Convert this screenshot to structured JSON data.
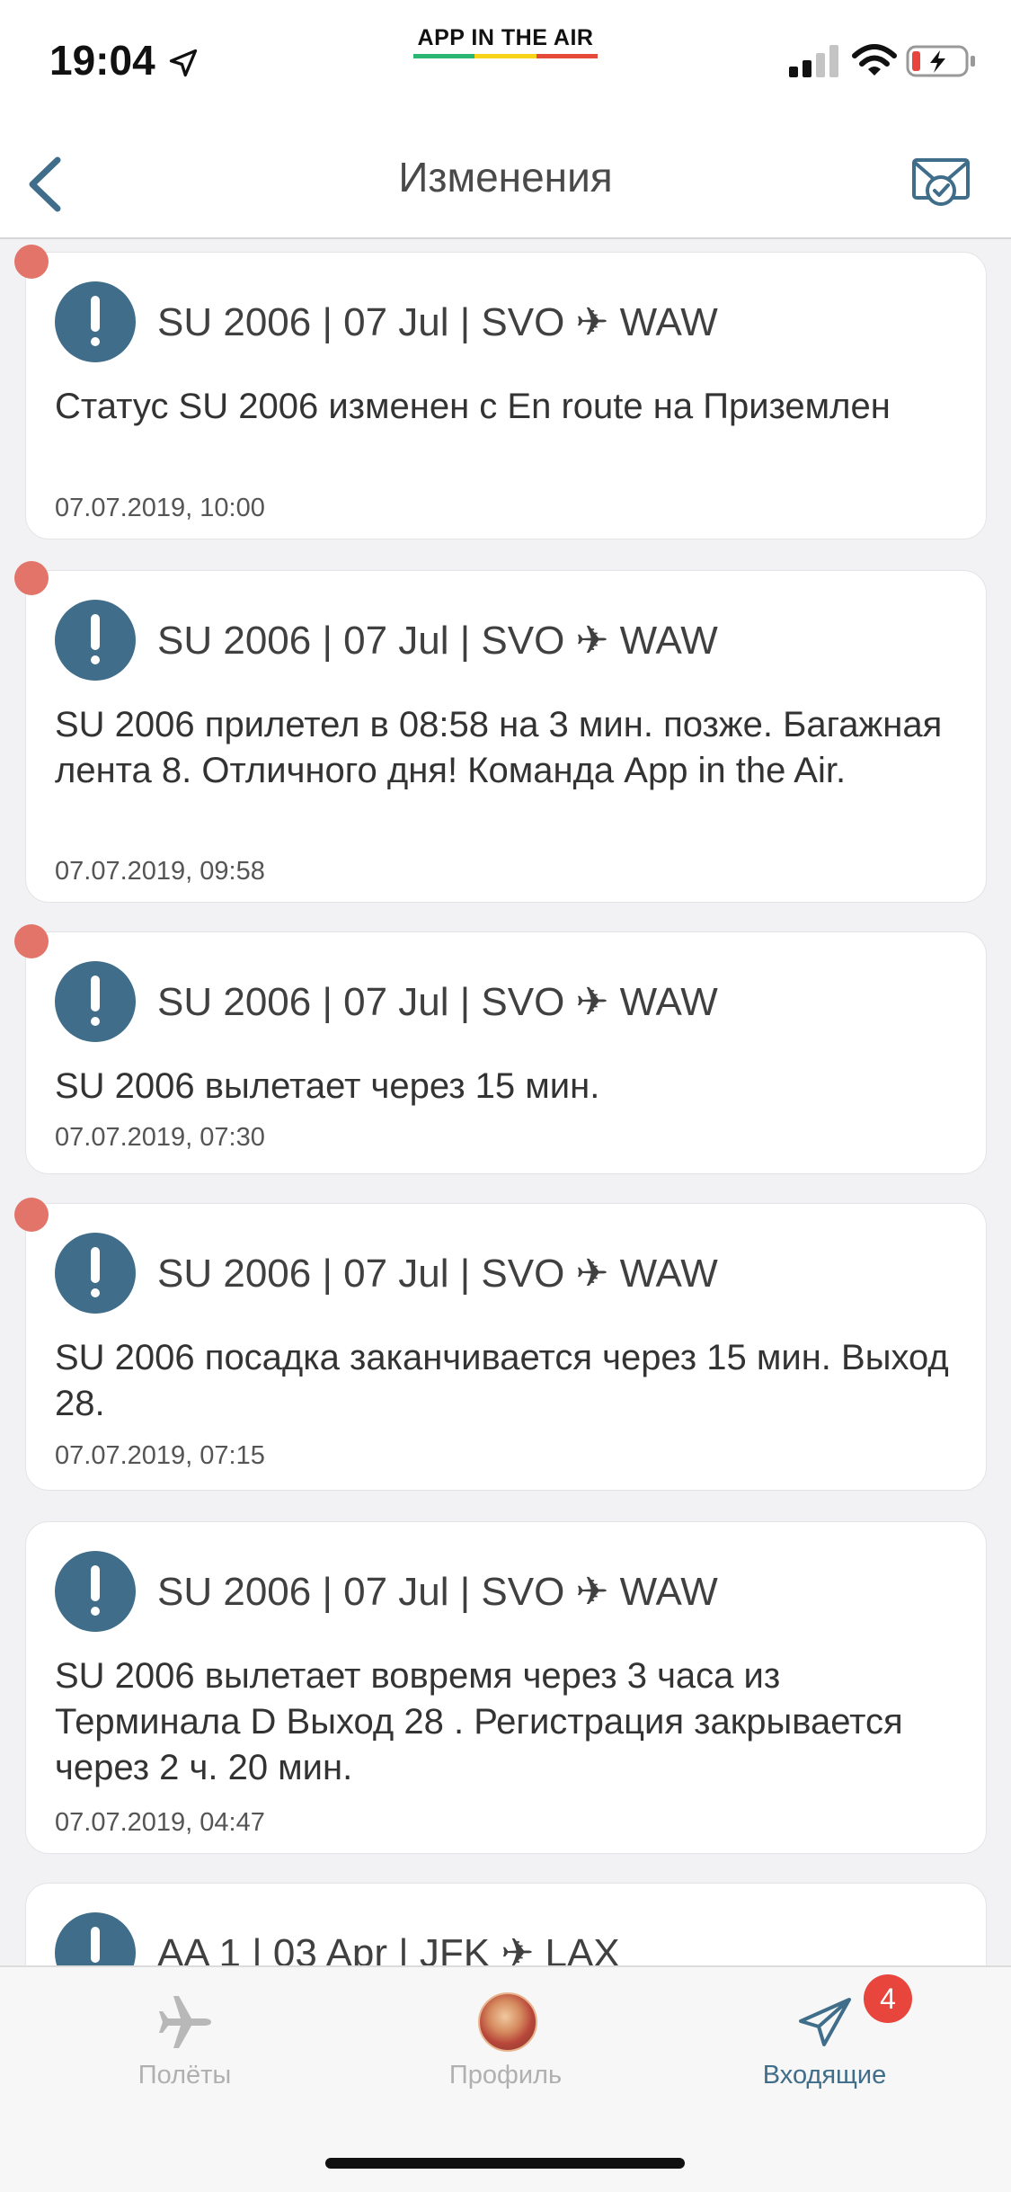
{
  "status_bar": {
    "time": "19:04",
    "carrier_text": "APP IN THE AIR",
    "brand_colors": [
      "#2bb673",
      "#f7d417",
      "#e64a3b"
    ]
  },
  "header": {
    "title": "Изменения",
    "back_icon": "chevron-left-icon",
    "action_icon": "mail-check-icon"
  },
  "colors": {
    "accent": "#3f6d8a",
    "unread": "#e27469",
    "badge": "#e8453c"
  },
  "notifications": [
    {
      "title": "SU 2006 | 07 Jul | SVO ✈ WAW",
      "body": "Статус SU 2006 изменен с En route на Приземлен",
      "time": "07.07.2019, 10:00",
      "unread": true
    },
    {
      "title": "SU 2006 | 07 Jul | SVO ✈ WAW",
      "body": "SU 2006 прилетел в 08:58 на 3 мин. позже. Багажная лента 8. Отличного дня! Команда App in the Air.",
      "time": "07.07.2019, 09:58",
      "unread": true
    },
    {
      "title": "SU 2006 | 07 Jul | SVO ✈ WAW",
      "body": "SU 2006 вылетает через 15 мин.",
      "time": "07.07.2019, 07:30",
      "unread": true
    },
    {
      "title": "SU 2006 | 07 Jul | SVO ✈ WAW",
      "body": "SU 2006 посадка заканчивается через 15 мин. Выход 28.",
      "time": "07.07.2019, 07:15",
      "unread": true
    },
    {
      "title": "SU 2006 | 07 Jul | SVO ✈ WAW",
      "body": "SU 2006 вылетает вовремя через 3 часа из Терминала D Выход 28 . Регистрация закрывается через 2 ч. 20 мин.",
      "time": "07.07.2019, 04:47",
      "unread": false
    },
    {
      "title": "AA 1 | 03 Apr | JFK ✈ LAX",
      "body": "",
      "time": "",
      "unread": false
    }
  ],
  "tabs": [
    {
      "label": "Полёты",
      "icon": "airplane-icon",
      "active": false
    },
    {
      "label": "Профиль",
      "icon": "avatar",
      "active": false
    },
    {
      "label": "Входящие",
      "icon": "paper-plane-icon",
      "active": true,
      "badge": "4"
    }
  ]
}
